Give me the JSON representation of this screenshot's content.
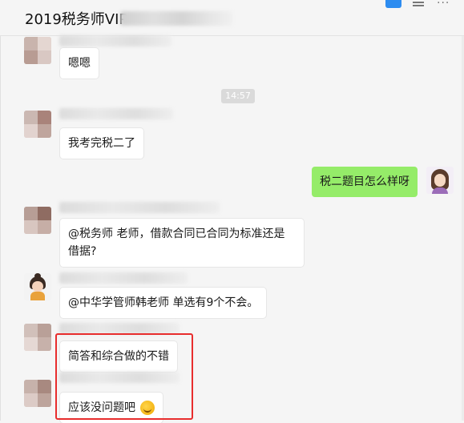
{
  "header": {
    "title": "2019税务师VIP",
    "icons": [
      "chat-active-icon",
      "menu-lines-icon",
      "more-dots-icon"
    ]
  },
  "timestamp": "14:57",
  "messages": [
    {
      "sender": "other",
      "text": "嗯嗯"
    },
    {
      "sender": "other",
      "text": "我考完税二了"
    },
    {
      "sender": "me",
      "text": "税二题目怎么样呀"
    },
    {
      "sender": "other",
      "text": "@税务师 老师，借款合同已合同为标准还是借据?"
    },
    {
      "sender": "other",
      "text": "@中华学管师韩老师 单选有9个不会。"
    },
    {
      "sender": "other",
      "text": "简答和综合做的不错"
    },
    {
      "sender": "other",
      "text": "应该没问题吧",
      "emoji": "grin-emoji-icon"
    }
  ],
  "colors": {
    "self_bubble": "#95ec69",
    "other_bubble": "#ffffff",
    "highlight": "#e82d2d",
    "background": "#f5f5f5"
  }
}
